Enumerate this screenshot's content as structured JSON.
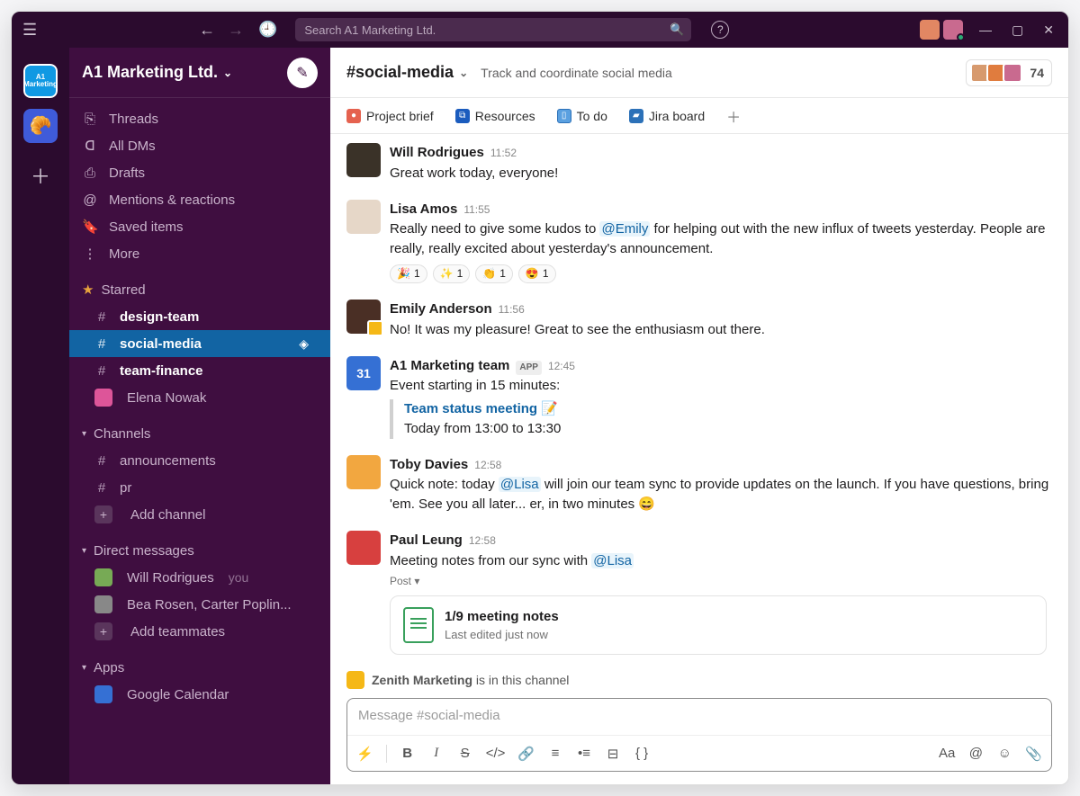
{
  "titlebar": {
    "search_placeholder": "Search A1 Marketing Ltd."
  },
  "workspace": {
    "name": "A1 Marketing Ltd.",
    "rail_label_1": "A1 Marketing",
    "rail_glyph_2": "🥐"
  },
  "sidebar": {
    "threads": "Threads",
    "all_dms": "All DMs",
    "drafts": "Drafts",
    "mentions": "Mentions & reactions",
    "saved": "Saved items",
    "more": "More",
    "starred_label": "Starred",
    "starred": [
      {
        "name": "design-team"
      },
      {
        "name": "social-media"
      },
      {
        "name": "team-finance"
      },
      {
        "name": "Elena Nowak"
      }
    ],
    "channels_label": "Channels",
    "channels": [
      {
        "name": "announcements"
      },
      {
        "name": "pr"
      }
    ],
    "add_channel": "Add channel",
    "dms_label": "Direct messages",
    "dms": [
      {
        "name": "Will Rodrigues",
        "suffix": "you"
      },
      {
        "name": "Bea Rosen, Carter Poplin..."
      }
    ],
    "add_teammates": "Add teammates",
    "apps_label": "Apps",
    "apps": [
      {
        "name": "Google Calendar"
      }
    ]
  },
  "channel_header": {
    "name": "#social-media",
    "topic": "Track and coordinate social media",
    "member_count": "74"
  },
  "bookmarks": [
    {
      "label": "Project brief"
    },
    {
      "label": "Resources"
    },
    {
      "label": "To do"
    },
    {
      "label": "Jira board"
    }
  ],
  "messages": [
    {
      "author": "Will Rodrigues",
      "time": "11:52",
      "text": "Great work today, everyone!"
    },
    {
      "author": "Lisa Amos",
      "time": "11:55",
      "pre": "Really need to give some kudos to ",
      "mention": "@Emily",
      "post": " for helping out with the new influx of tweets yesterday. People are really, really excited about yesterday's announcement.",
      "reactions": [
        "🎉",
        "✨",
        "👏",
        "😍"
      ]
    },
    {
      "author": "Emily Anderson",
      "time": "11:56",
      "text": "No! It was my pleasure! Great to see the enthusiasm out there."
    },
    {
      "author": "A1 Marketing team",
      "time": "12:45",
      "app": "APP",
      "text": "Event starting in 15 minutes:",
      "event_title": "Team status meeting",
      "event_time": "Today from 13:00 to 13:30"
    },
    {
      "author": "Toby Davies",
      "time": "12:58",
      "pre": "Quick note: today ",
      "mention": "@Lisa",
      "post": " will join our team sync to provide updates on the launch. If you have questions, bring 'em. See you all later... er, in two minutes 😄"
    },
    {
      "author": "Paul Leung",
      "time": "12:58",
      "pre": "Meeting notes from our sync with ",
      "mention": "@Lisa",
      "post_label": "Post ▾",
      "attach_title": "1/9 meeting notes",
      "attach_sub": "Last edited just now"
    }
  ],
  "notice": {
    "name": "Zenith Marketing",
    "text": " is in this channel"
  },
  "composer": {
    "placeholder": "Message #social-media"
  }
}
